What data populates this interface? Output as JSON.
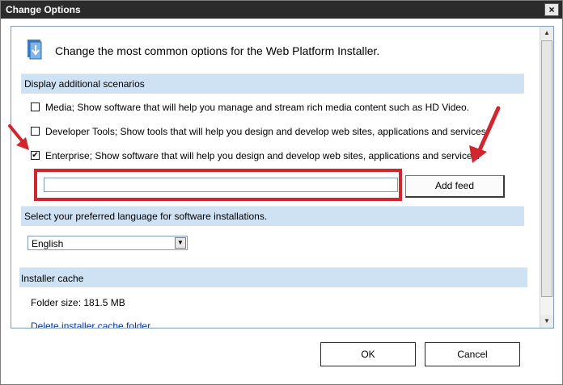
{
  "window": {
    "title": "Change Options",
    "close_glyph": "×"
  },
  "header": {
    "text": "Change the most common options for the Web Platform Installer.",
    "icon": "installer-icon"
  },
  "scenarios": {
    "section_title": "Display additional scenarios",
    "items": [
      {
        "label": "Media; Show software that will help you manage and stream rich media content such as HD Video.",
        "checked": false
      },
      {
        "label": "Developer Tools; Show tools that will help you design and develop web sites, applications and services.",
        "checked": false
      },
      {
        "label": "Enterprise; Show software that will help you design and develop web sites, applications and services.",
        "checked": true
      }
    ],
    "feed_input_value": "",
    "add_feed_label": "Add feed"
  },
  "language": {
    "section_title": "Select your preferred language for software installations.",
    "selected": "English"
  },
  "cache": {
    "section_title": "Installer cache",
    "folder_size": "Folder size: 181.5 MB",
    "delete_link": "Delete installer cache folder"
  },
  "buttons": {
    "ok": "OK",
    "cancel": "Cancel"
  },
  "colors": {
    "section_bg": "#cfe2f3",
    "title_bar": "#2b2b2b",
    "annotation_red": "#d1262f",
    "link": "#0033aa"
  }
}
